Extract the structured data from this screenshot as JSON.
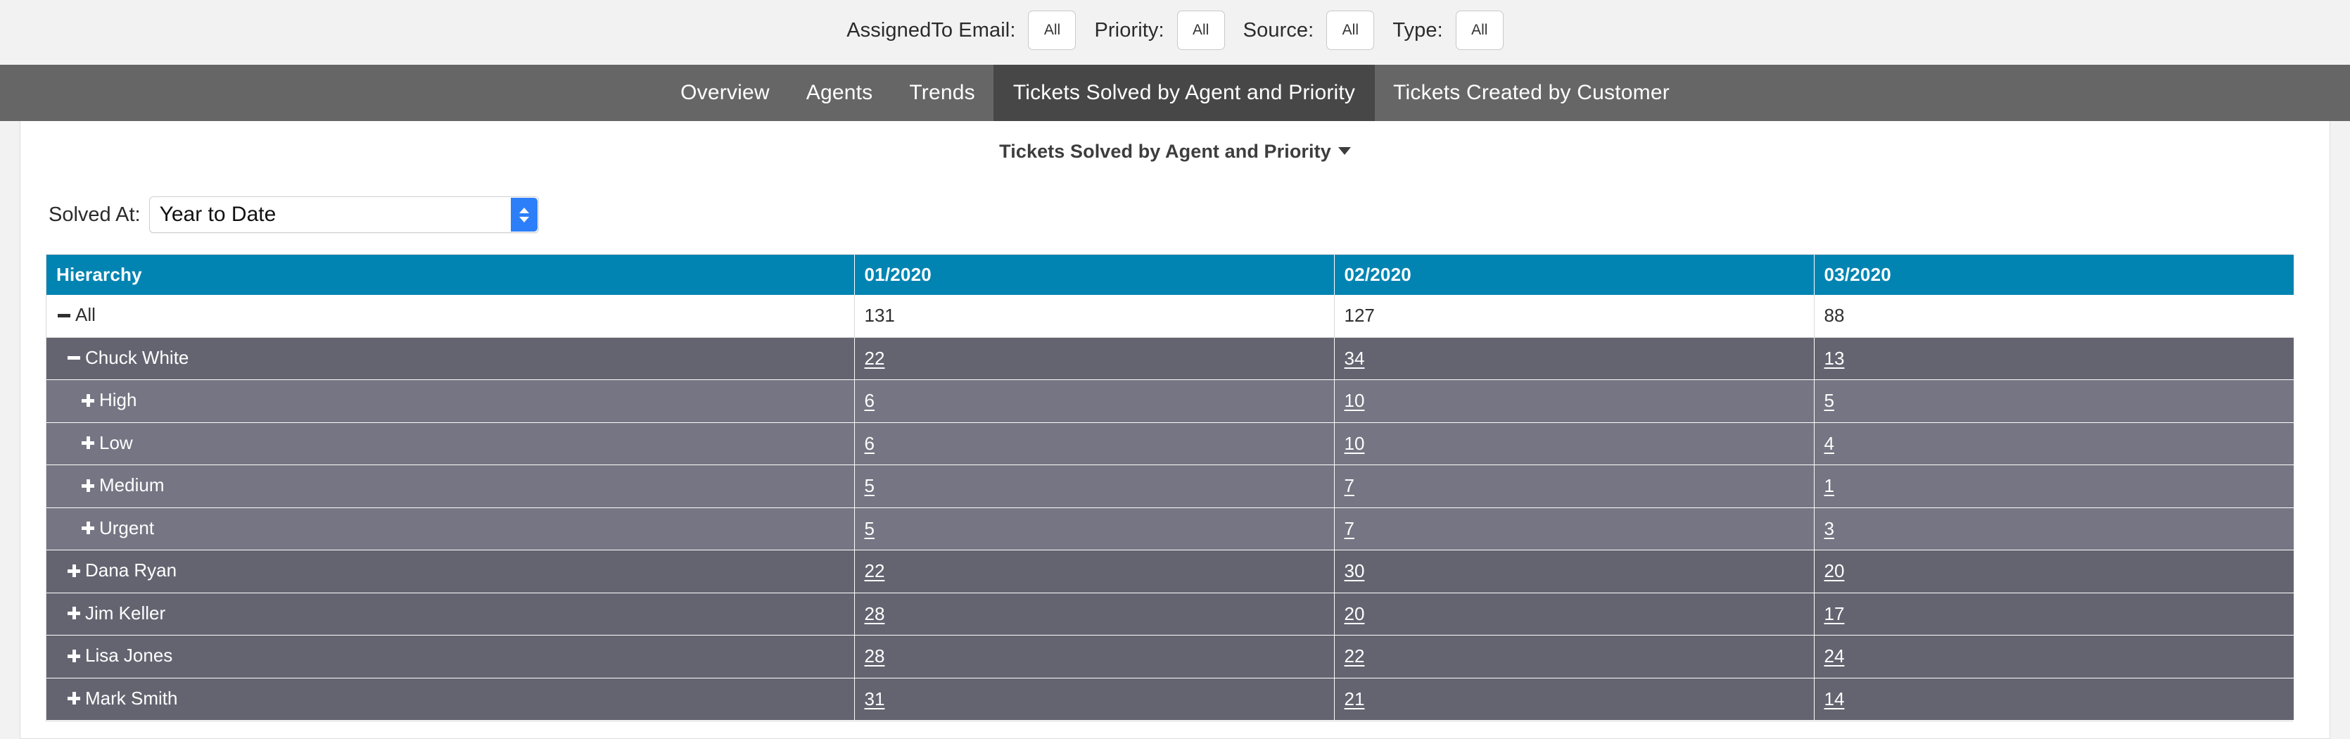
{
  "filters": [
    {
      "label": "AssignedTo Email:",
      "value": "All",
      "name": "assignedto-email"
    },
    {
      "label": "Priority:",
      "value": "All",
      "name": "priority"
    },
    {
      "label": "Source:",
      "value": "All",
      "name": "source"
    },
    {
      "label": "Type:",
      "value": "All",
      "name": "type"
    }
  ],
  "nav": {
    "tabs": [
      {
        "label": "Overview",
        "active": false
      },
      {
        "label": "Agents",
        "active": false
      },
      {
        "label": "Trends",
        "active": false
      },
      {
        "label": "Tickets Solved by Agent and Priority",
        "active": true
      },
      {
        "label": "Tickets Created by Customer",
        "active": false
      }
    ]
  },
  "report": {
    "title": "Tickets Solved by Agent and Priority",
    "title_caret": "chevron-down-icon"
  },
  "solved_at": {
    "label": "Solved At:",
    "value": "Year to Date"
  },
  "colors": {
    "navbar": "#666666",
    "nav_active": "#474747",
    "table_header": "#0284b2",
    "row_agent": "#646471",
    "row_priority": "#757583",
    "stepper": "#2d7ff9",
    "page_bg": "#f2f2f2"
  },
  "chart_data": {
    "type": "table",
    "title": "Tickets Solved by Agent and Priority",
    "columns": [
      "Hierarchy",
      "01/2020",
      "02/2020",
      "03/2020"
    ],
    "rows": [
      {
        "label": "All",
        "level": 1,
        "icon": "minus",
        "values": [
          "131",
          "127",
          "88"
        ],
        "link": false
      },
      {
        "label": "Chuck White",
        "level": 2,
        "icon": "minus",
        "values": [
          "22",
          "34",
          "13"
        ],
        "link": true
      },
      {
        "label": "High",
        "level": 3,
        "icon": "plus",
        "values": [
          "6",
          "10",
          "5"
        ],
        "link": true
      },
      {
        "label": "Low",
        "level": 3,
        "icon": "plus",
        "values": [
          "6",
          "10",
          "4"
        ],
        "link": true
      },
      {
        "label": "Medium",
        "level": 3,
        "icon": "plus",
        "values": [
          "5",
          "7",
          "1"
        ],
        "link": true
      },
      {
        "label": "Urgent",
        "level": 3,
        "icon": "plus",
        "values": [
          "5",
          "7",
          "3"
        ],
        "link": true
      },
      {
        "label": "Dana Ryan",
        "level": 2,
        "icon": "plus",
        "values": [
          "22",
          "30",
          "20"
        ],
        "link": true
      },
      {
        "label": "Jim Keller",
        "level": 2,
        "icon": "plus",
        "values": [
          "28",
          "20",
          "17"
        ],
        "link": true
      },
      {
        "label": "Lisa Jones",
        "level": 2,
        "icon": "plus",
        "values": [
          "28",
          "22",
          "24"
        ],
        "link": true
      },
      {
        "label": "Mark Smith",
        "level": 2,
        "icon": "plus",
        "values": [
          "31",
          "21",
          "14"
        ],
        "link": true
      }
    ]
  }
}
